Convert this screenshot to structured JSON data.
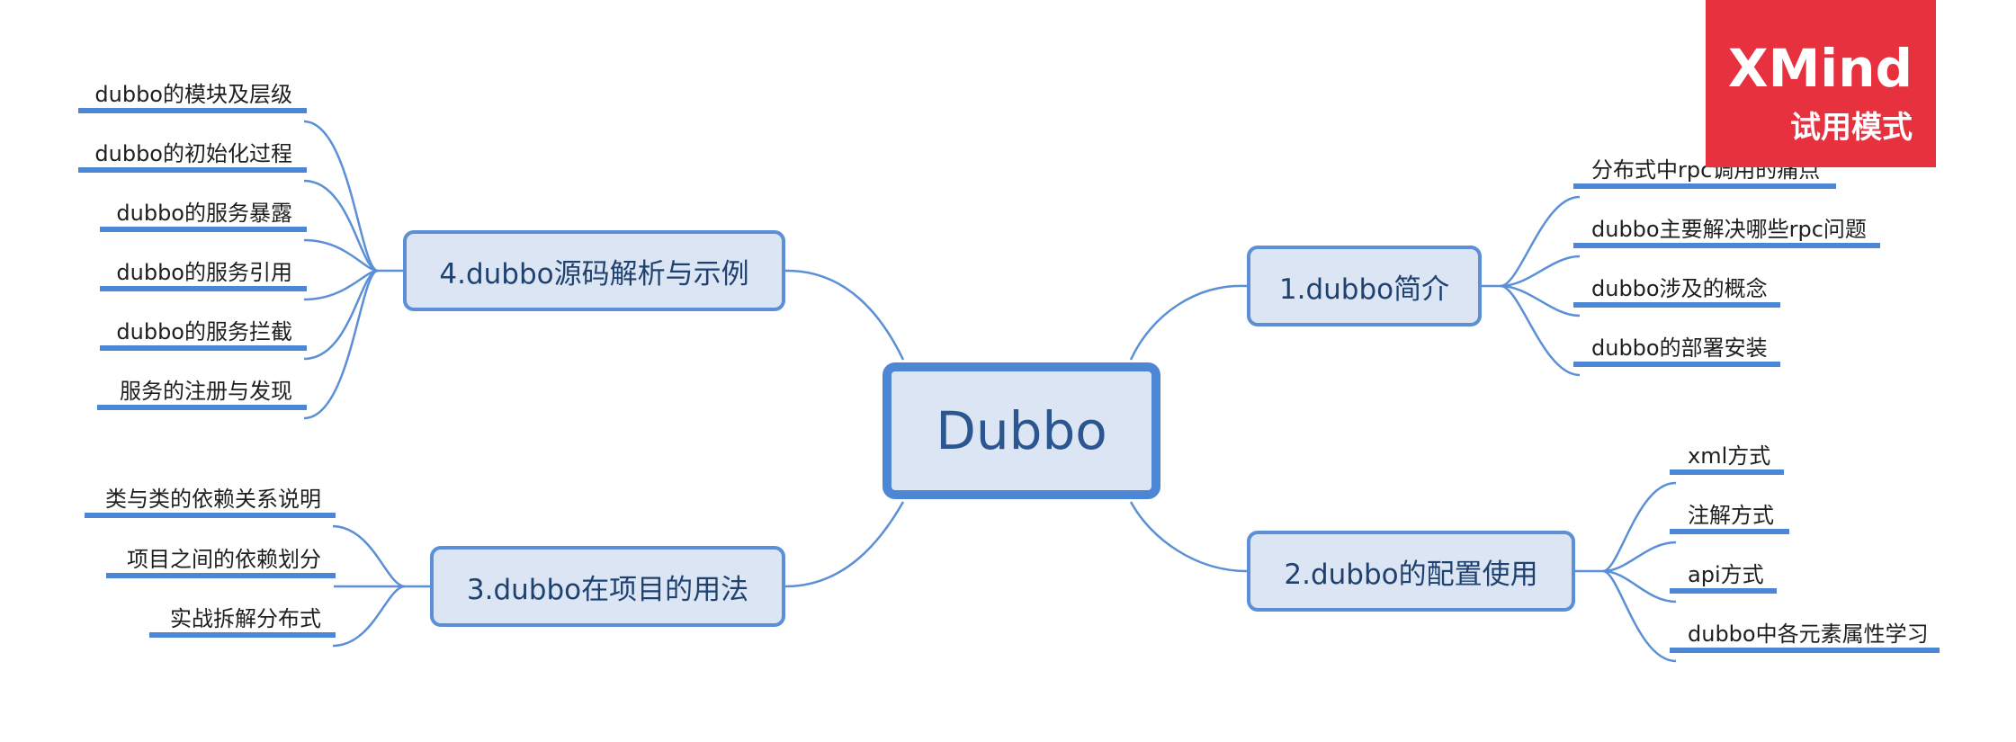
{
  "central": {
    "label": "Dubbo"
  },
  "branches": [
    {
      "label": "1.dubbo简介",
      "items": [
        "分布式中rpc调用的痛点",
        "dubbo主要解决哪些rpc问题",
        "dubbo涉及的概念",
        "dubbo的部署安装"
      ]
    },
    {
      "label": "2.dubbo的配置使用",
      "items": [
        "xml方式",
        "注解方式",
        "api方式",
        "dubbo中各元素属性学习"
      ]
    },
    {
      "label": "3.dubbo在项目的用法",
      "items": [
        "类与类的依赖关系说明",
        "项目之间的依赖划分",
        "实战拆解分布式"
      ]
    },
    {
      "label": "4.dubbo源码解析与示例",
      "items": [
        "dubbo的模块及层级",
        "dubbo的初始化过程",
        "dubbo的服务暴露",
        "dubbo的服务引用",
        "dubbo的服务拦截",
        "服务的注册与发现"
      ]
    }
  ],
  "watermark": {
    "title": "XMind",
    "subtitle": "试用模式"
  },
  "colors": {
    "line": "#4d86d4",
    "topic_fill": "#dbe5f3",
    "watermark": "#e8313f"
  }
}
